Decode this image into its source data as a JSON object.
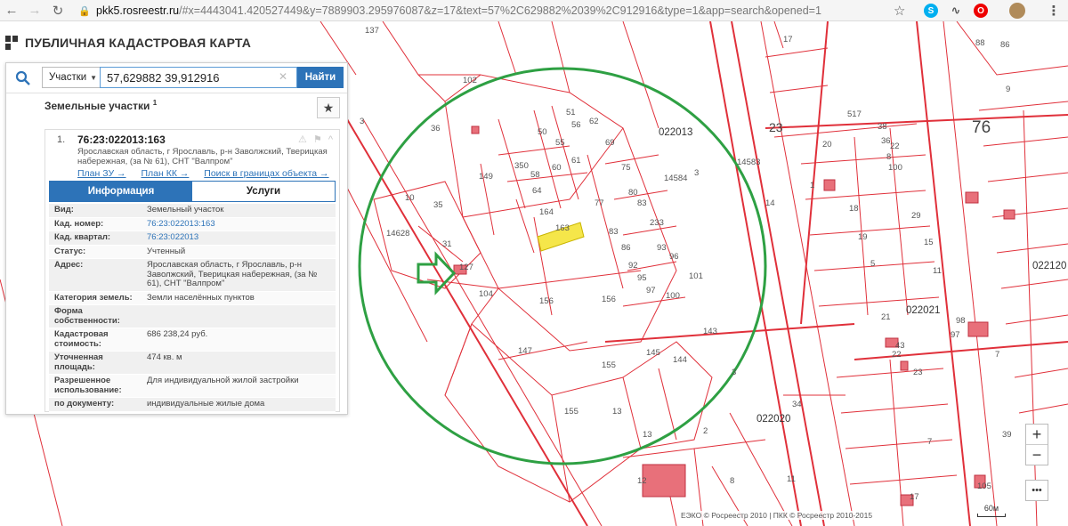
{
  "browser": {
    "url_host": "pkk5.rosreestr.ru",
    "url_rest": "/#x=4443041.420527449&y=7889903.295976087&z=17&text=57%2C629882%2039%2C912916&type=1&app=search&opened=1"
  },
  "site": {
    "title": "ПУБЛИЧНАЯ КАДАСТРОВАЯ КАРТА"
  },
  "search": {
    "type": "Участки",
    "query": "57,629882 39,912916",
    "button": "Найти"
  },
  "list": {
    "header": "Земельные участки",
    "count_sup": "1"
  },
  "result": {
    "number": "1.",
    "cadastral": "76:23:022013:163",
    "address": "Ярославская область, г Ярославль, р-н Заволжский, Тверицкая набережная, (за № 61), СНТ \"Валпром\"",
    "links": [
      "План ЗУ →",
      "План КК →",
      "Поиск в границах объекта →"
    ]
  },
  "tabs": [
    "Информация",
    "Услуги"
  ],
  "info_rows": [
    {
      "k": "Вид:",
      "v": "Земельный участок"
    },
    {
      "k": "Кад. номер:",
      "v": "76:23:022013:163"
    },
    {
      "k": "Кад. квартал:",
      "v": "76:23:022013"
    },
    {
      "k": "Статус:",
      "v": "Учтенный"
    },
    {
      "k": "Адрес:",
      "v": "Ярославская область, г Ярославль, р-н Заволжский, Тверицкая набережная, (за № 61), СНТ \"Валпром\""
    },
    {
      "k": "Категория земель:",
      "v": "Земли населённых пунктов"
    },
    {
      "k": "Форма собственности:",
      "v": ""
    },
    {
      "k": "Кадастровая стоимость:",
      "v": "686 238,24 руб."
    },
    {
      "k": "Уточненная площадь:",
      "v": "474 кв. м"
    },
    {
      "k": "Разрешенное использование:",
      "v": "Для индивидуальной жилой застройки"
    },
    {
      "k": "по документу:",
      "v": "индивидуальные жилые дома"
    }
  ],
  "map_labels": {
    "big": [
      "76",
      "23"
    ],
    "zones": [
      "022013",
      "022021",
      "022020",
      "022120"
    ],
    "parcels": [
      "137",
      "17",
      "88",
      "86",
      "9",
      "102",
      "51",
      "50",
      "56",
      "62",
      "36",
      "3",
      "55",
      "60",
      "61",
      "69",
      "14583",
      "14584",
      "517",
      "38",
      "20",
      "36",
      "8",
      "22",
      "10",
      "35",
      "149",
      "350",
      "58",
      "64",
      "164",
      "163",
      "83",
      "75",
      "77",
      "80",
      "83",
      "233",
      "86",
      "1",
      "3",
      "14",
      "100",
      "18",
      "29",
      "19",
      "15",
      "5",
      "11",
      "31",
      "127",
      "104",
      "156",
      "156",
      "92",
      "95",
      "97",
      "93",
      "96",
      "101",
      "100",
      "21",
      "43",
      "22",
      "23",
      "98",
      "97",
      "7",
      "14628",
      "147",
      "155",
      "145",
      "144",
      "143",
      "3",
      "34",
      "155",
      "13",
      "13",
      "12",
      "39",
      "2",
      "11",
      "8",
      "105",
      "17",
      "7"
    ]
  },
  "controls": {
    "zoom_in": "+",
    "zoom_out": "−",
    "more": "•••"
  },
  "attribution": "ЕЭКО © Росреестр 2010 | ПКК © Росреестр 2010-2015",
  "scale_label": "60м",
  "colors": {
    "parcel_line": "#e0303a",
    "circle": "#2ea043",
    "accent": "#2d73b8",
    "highlight": "#f5e64a"
  }
}
